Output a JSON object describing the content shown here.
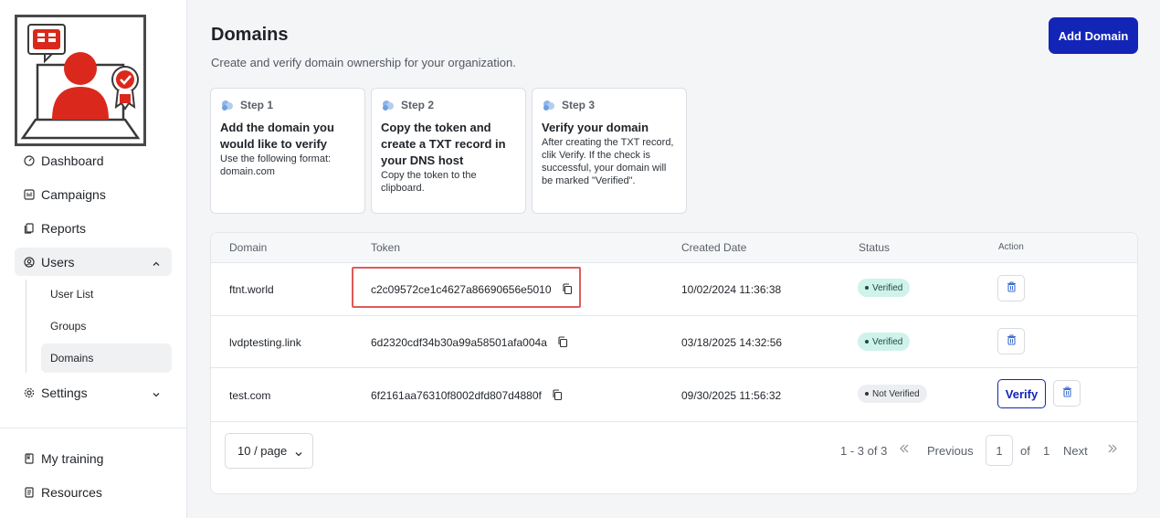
{
  "sidebar": {
    "nav": [
      {
        "label": "Dashboard",
        "icon": "gauge-icon"
      },
      {
        "label": "Campaigns",
        "icon": "campaign-icon"
      },
      {
        "label": "Reports",
        "icon": "reports-icon"
      },
      {
        "label": "Users",
        "icon": "user-circle-icon"
      }
    ],
    "users_sub": [
      "User List",
      "Groups",
      "Domains"
    ],
    "settings": {
      "label": "Settings",
      "icon": "gear-icon"
    },
    "bottom": [
      {
        "label": "My training",
        "icon": "book-icon"
      },
      {
        "label": "Resources",
        "icon": "resources-icon"
      }
    ]
  },
  "page": {
    "title": "Domains",
    "subtitle": "Create and verify domain ownership for your organization.",
    "add_button": "Add Domain"
  },
  "steps": [
    {
      "label": "Step 1",
      "title": "Add the domain you would like to verify",
      "desc": "Use the following format: domain.com"
    },
    {
      "label": "Step 2",
      "title": "Copy the token and create a TXT record in your DNS host",
      "desc": "Copy the token to the clipboard."
    },
    {
      "label": "Step 3",
      "title": "Verify your domain",
      "desc": "After creating the TXT record, clik Verify. If the check is successful, your domain will be marked \"Verified\"."
    }
  ],
  "table": {
    "headers": {
      "domain": "Domain",
      "token": "Token",
      "created": "Created Date",
      "status": "Status",
      "action": "Action"
    },
    "rows": [
      {
        "domain": "ftnt.world",
        "token": "c2c09572ce1c4627a86690656e5010",
        "created": "10/02/2024 11:36:38",
        "status": "Verified"
      },
      {
        "domain": "lvdptesting.link",
        "token": "6d2320cdf34b30a99a58501afa004a",
        "created": "03/18/2025 14:32:56",
        "status": "Verified"
      },
      {
        "domain": "test.com",
        "token": "6f2161aa76310f8002dfd807d4880f",
        "created": "09/30/2025 11:56:32",
        "status": "Not Verified",
        "verify_label": "Verify"
      }
    ]
  },
  "pagination": {
    "page_size": "10 / page",
    "range": "1 - 3 of 3",
    "previous": "Previous",
    "current": "1",
    "of": "of",
    "total": "1",
    "next": "Next"
  },
  "colors": {
    "accent": "#1225b6",
    "verified_bg": "#cff3ea",
    "highlight": "#e05a5a",
    "brand_red": "#da291c"
  }
}
